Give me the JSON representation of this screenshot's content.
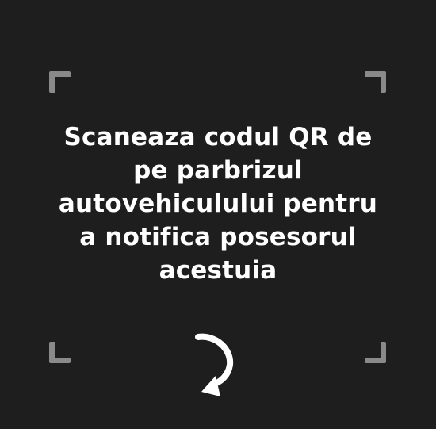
{
  "scanner": {
    "instruction": "Scaneaza codul QR de pe parbrizul autovehiculului pentru a notifica posesorul acestuia",
    "frame_color": "#8a8a8a",
    "background_color": "#1e1e1e",
    "text_color": "#ffffff",
    "rotate_icon": "rotate-cw-icon"
  }
}
